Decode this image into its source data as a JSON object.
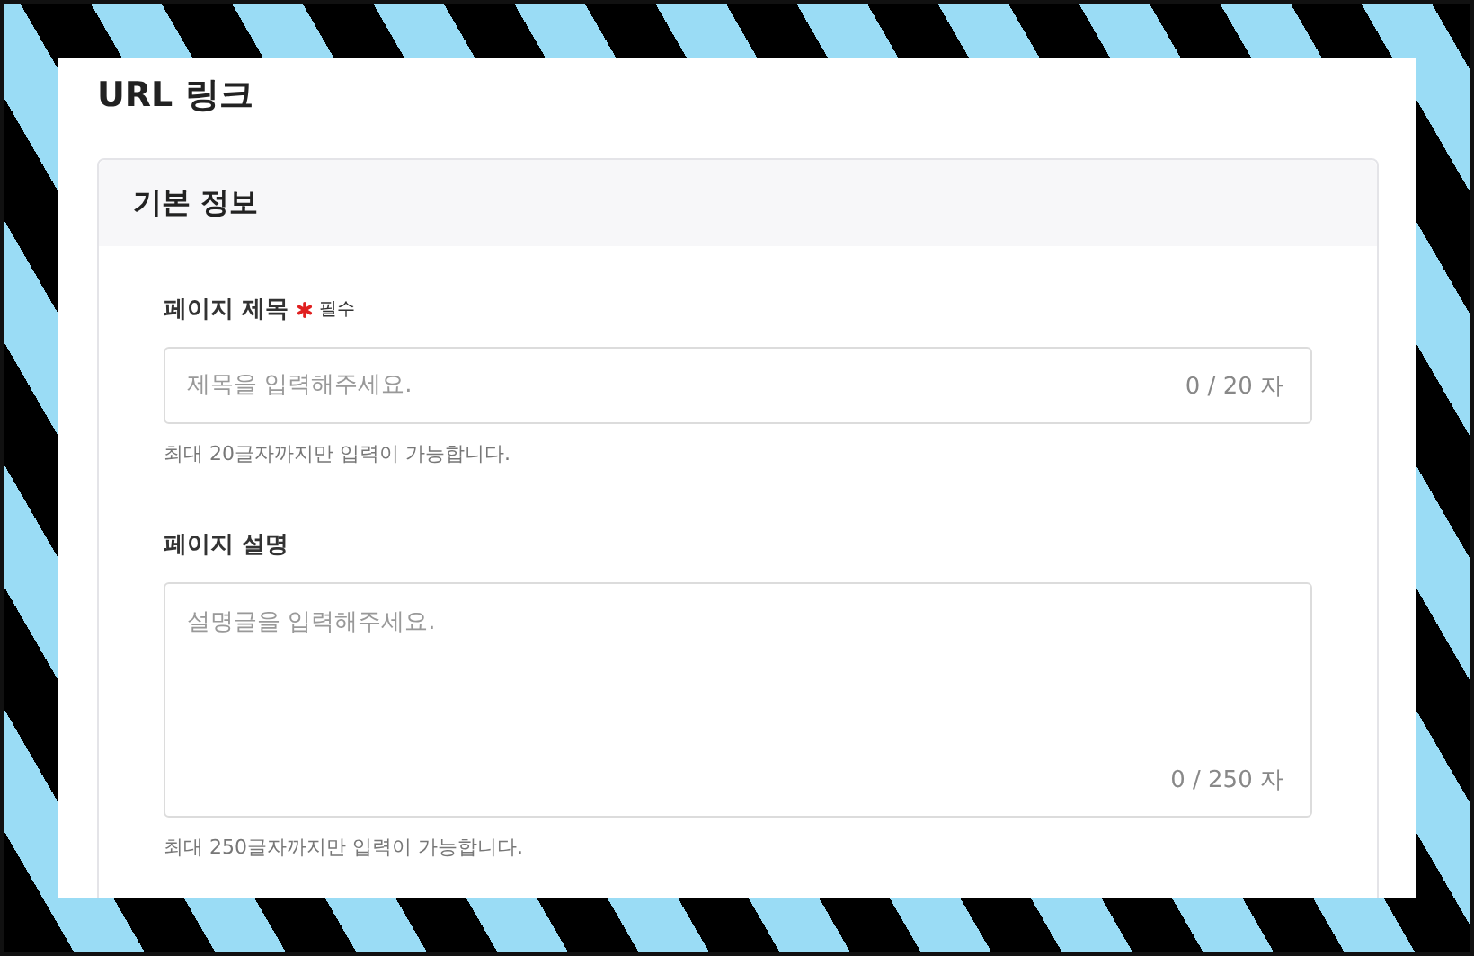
{
  "page": {
    "title": "URL 링크"
  },
  "section": {
    "title": "기본 정보",
    "fields": [
      {
        "kind": "input",
        "label": "페이지 제목",
        "required": true,
        "required_text": "필수",
        "placeholder": "제목을 입력해주세요.",
        "counter": "0 / 20 자",
        "help": "최대 20글자까지만 입력이 가능합니다."
      },
      {
        "kind": "textarea",
        "label": "페이지 설명",
        "required": false,
        "placeholder": "설명글을 입력해주세요.",
        "counter": "0 / 250 자",
        "help": "최대 250글자까지만 입력이 가능합니다."
      }
    ]
  }
}
